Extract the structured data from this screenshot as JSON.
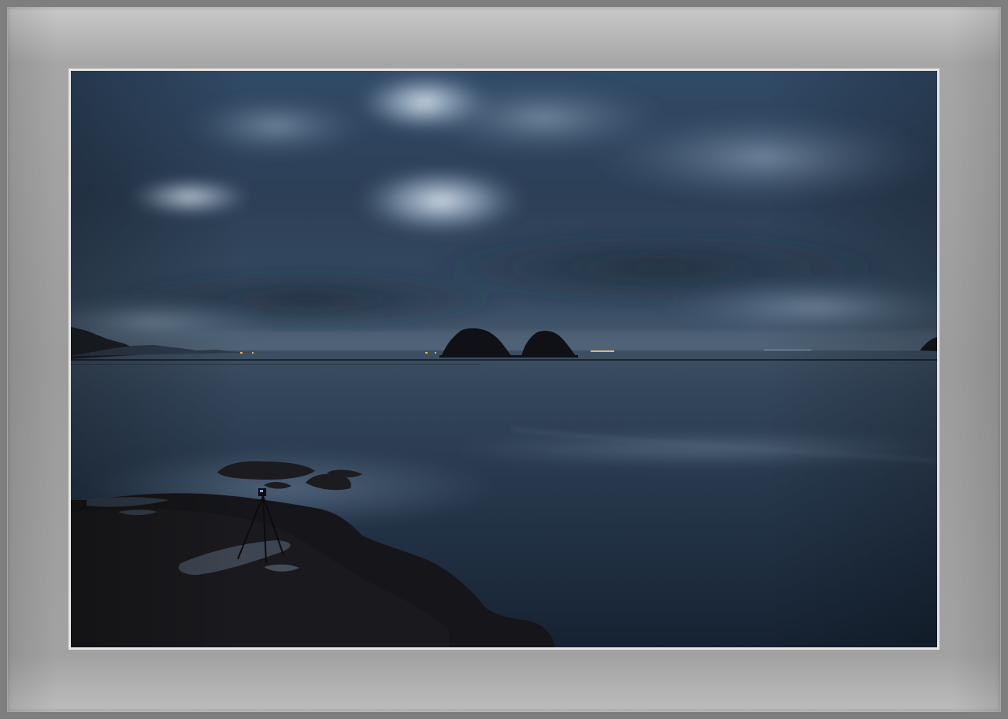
{
  "scene": {
    "subject": "coastal-night-seascape",
    "elements": [
      "storm-clouds",
      "calm-sea",
      "two-rock-islets",
      "distant-shoreline-lights",
      "foreground-rocks",
      "tripod-camera"
    ]
  },
  "colors": {
    "frame_outer": "#7e7e7e",
    "frame_light": "#c9c9c9",
    "mat": "#e6e6e6",
    "sky_dark": "#27374a",
    "sky_mid": "#3a5370",
    "cloud_light": "#c4d3e3",
    "sea_dark": "#172332",
    "sea_mid": "#2c3c50",
    "rock": "#17161a",
    "shore_light": "#f0b050"
  }
}
